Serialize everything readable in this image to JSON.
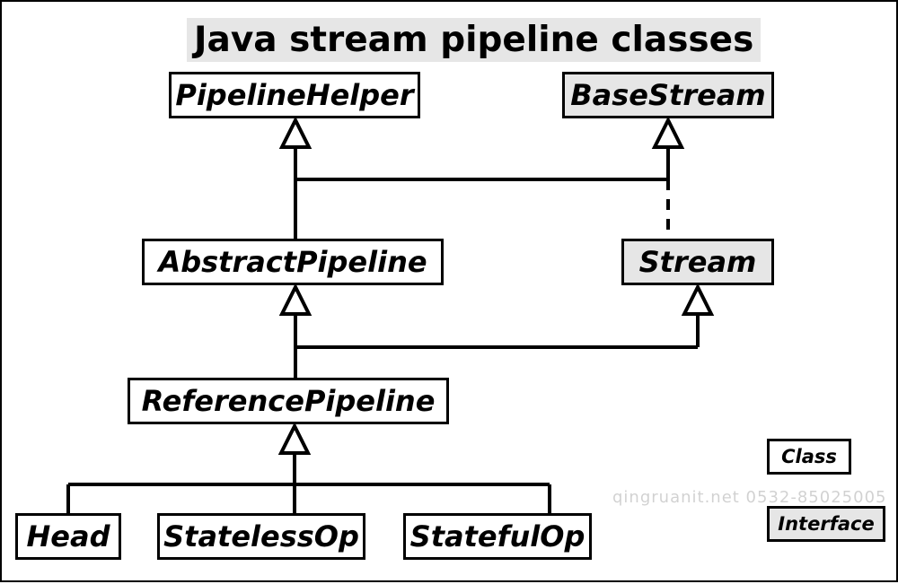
{
  "title": "Java stream pipeline classes",
  "nodes": {
    "pipelineHelper": "PipelineHelper",
    "baseStream": "BaseStream",
    "abstractPipeline": "AbstractPipeline",
    "stream": "Stream",
    "referencePipeline": "ReferencePipeline",
    "head": "Head",
    "statelessOp": "StatelessOp",
    "statefulOp": "StatefulOp"
  },
  "legend": {
    "class": "Class",
    "interface": "Interface"
  },
  "watermark": "qingruanit.net 0532-85025005"
}
